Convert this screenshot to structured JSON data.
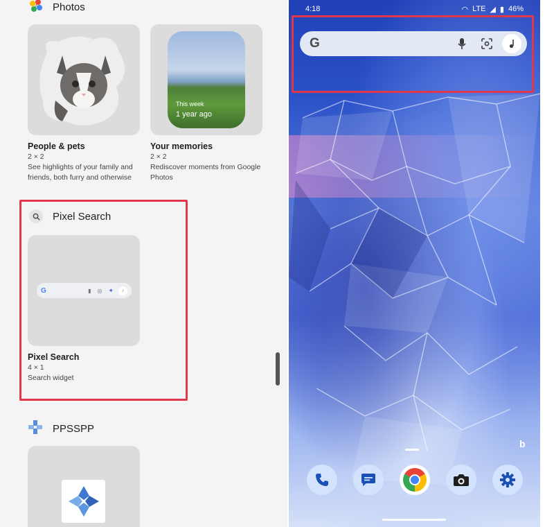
{
  "picker": {
    "photos_app": {
      "name": "Photos"
    },
    "widgets_photos": [
      {
        "title": "People & pets",
        "size": "2 × 2",
        "description": "See highlights of your family and friends, both furry and otherwise"
      },
      {
        "title": "Your memories",
        "size": "2 × 2",
        "description": "Rediscover moments from Google Photos",
        "overlay_line1": "This week",
        "overlay_line2": "1 year ago"
      }
    ],
    "pixel_search_app": {
      "name": "Pixel Search"
    },
    "pixel_search_widget": {
      "title": "Pixel Search",
      "size": "4 × 1",
      "description": "Search widget",
      "logo": "G"
    },
    "ppsspp_app": {
      "name": "PPSSPP"
    }
  },
  "home": {
    "status": {
      "time": "4:18",
      "network": "LTE",
      "battery": "46%"
    },
    "search_logo": "G",
    "bing": "b",
    "dock": [
      {
        "name": "phone-icon",
        "color": "#d3e3fd"
      },
      {
        "name": "messages-icon",
        "color": "#d3e3fd"
      },
      {
        "name": "chrome-icon",
        "color": "#ffffff"
      },
      {
        "name": "camera-icon",
        "color": "#d3e3fd"
      },
      {
        "name": "settings-icon",
        "color": "#d3e3fd"
      }
    ]
  },
  "colors": {
    "highlight": "#e0374a",
    "accent_blue": "#1a4fb5"
  }
}
